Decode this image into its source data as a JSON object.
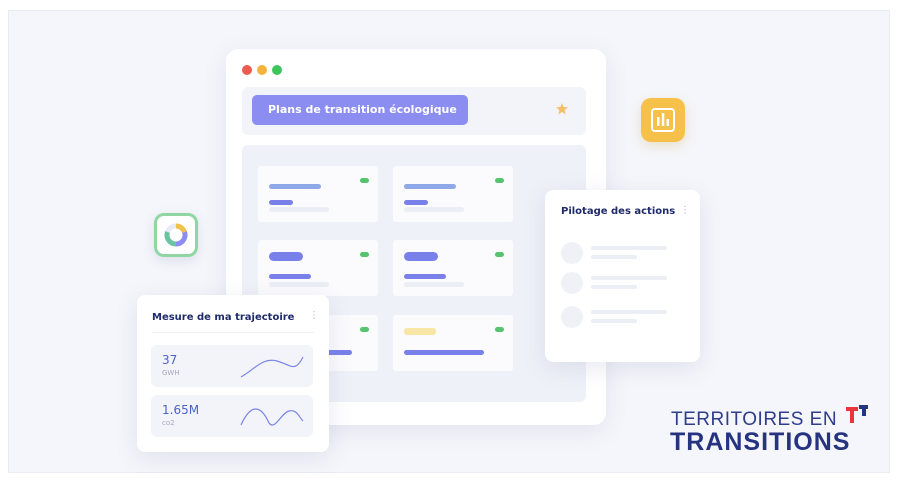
{
  "window": {
    "title_pill": "Plans de transition écologique",
    "dot_colors": [
      "#ec5b4f",
      "#f5b23c",
      "#3ec45b"
    ]
  },
  "trajectory_panel": {
    "title": "Mesure de ma trajectoire",
    "menu_glyph": "⋮",
    "metrics": [
      {
        "value": "37",
        "unit": "GWH"
      },
      {
        "value": "1.65M",
        "unit": "co2"
      }
    ]
  },
  "actions_panel": {
    "title": "Pilotage des actions",
    "menu_glyph": "⋮"
  },
  "icons": {
    "donut": "donut-chart-icon",
    "bars": "bar-chart-icon",
    "star": "star-icon"
  },
  "colors": {
    "accent_purple": "#8b8df0",
    "status_green": "#56c46e",
    "soft_yellow": "#f7e6a6",
    "brand_navy": "#26337f",
    "brand_red": "#e8363b",
    "icon_yellow": "#f5c14a",
    "icon_green": "#8fd6a3"
  },
  "logo": {
    "line1": "TERRITOIRES EN",
    "line2": "TRANSITIONS"
  }
}
